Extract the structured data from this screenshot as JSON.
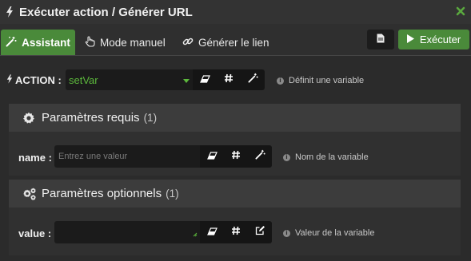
{
  "window": {
    "title": "Exécuter action / Générer URL"
  },
  "tabs": {
    "assistant": "Assistant",
    "manual": "Mode manuel",
    "link": "Générer le lien"
  },
  "toolbar": {
    "execute_label": "Exécuter"
  },
  "action": {
    "label": "ACTION :",
    "value": "setVar",
    "hint": "Définit une variable"
  },
  "required": {
    "title": "Paramètres requis",
    "count": "(1)",
    "fields": [
      {
        "label": "name :",
        "placeholder": "Entrez une valeur",
        "hint": "Nom de la variable"
      }
    ]
  },
  "optional": {
    "title": "Paramètres optionnels",
    "count": "(1)",
    "fields": [
      {
        "label": "value :",
        "placeholder": "",
        "hint": "Valeur de la variable"
      }
    ]
  },
  "colors": {
    "accent": "#4a8a3a",
    "value_text": "#5cb83c",
    "background": "#2b2b2b"
  },
  "icons": [
    "bolt-icon",
    "close-icon",
    "magic-wand-icon",
    "hand-pointer-icon",
    "link-icon",
    "document-icon",
    "play-icon",
    "eraser-icon",
    "hash-icon",
    "edit-icon",
    "info-icon",
    "gear-icon",
    "gears-icon"
  ]
}
